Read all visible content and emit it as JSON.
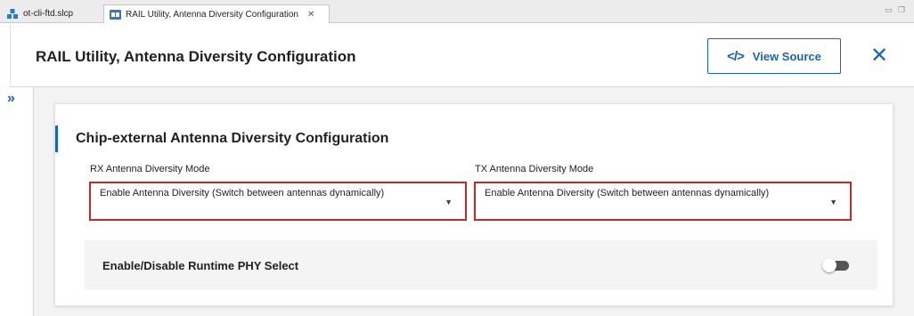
{
  "tabs": [
    {
      "label": "ot-cli-ftd.slcp",
      "icon": "project-icon",
      "active": false
    },
    {
      "label": "RAIL Utility, Antenna Diversity Configuration",
      "icon": "component-icon",
      "active": true,
      "close_glyph": "✕"
    }
  ],
  "header": {
    "title": "RAIL Utility, Antenna Diversity Configuration",
    "view_source_label": "View Source",
    "view_source_icon": "</>",
    "close_glyph": "✕"
  },
  "rail": {
    "expand_glyph": "»"
  },
  "section": {
    "title": "Chip-external Antenna Diversity Configuration",
    "rx": {
      "label": "RX Antenna Diversity Mode",
      "value": "Enable Antenna Diversity (Switch between antennas dynamically)"
    },
    "tx": {
      "label": "TX Antenna Diversity Mode",
      "value": "Enable Antenna Diversity (Switch between antennas dynamically)"
    },
    "runtime_phy": {
      "label": "Enable/Disable Runtime PHY Select",
      "enabled": false
    }
  },
  "colors": {
    "accent": "#1565c0",
    "error_border": "#c62828",
    "toggle_off": "#555555"
  }
}
